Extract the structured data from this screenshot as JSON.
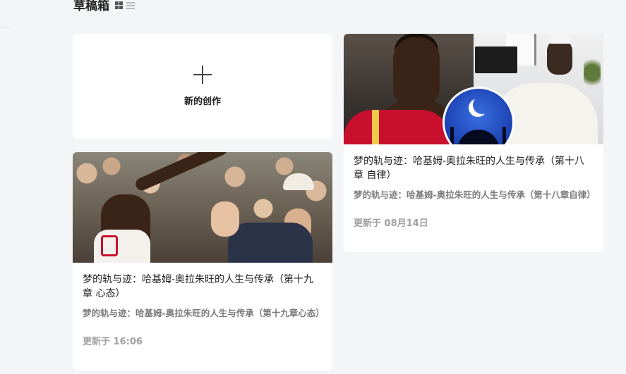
{
  "header": {
    "title": "草稿箱"
  },
  "new_card": {
    "label": "新的创作"
  },
  "drafts": [
    {
      "title": "梦的轨与迹：哈基姆-奥拉朱旺的人生与传承（第十八章 自律）",
      "excerpt": "梦的轨与迹：哈基姆-奥拉朱旺的人生与传承（第十八章自律）",
      "date": "更新于 08月14日"
    },
    {
      "title": "梦的轨与迹：哈基姆-奥拉朱旺的人生与传承（第十九章 心态）",
      "excerpt": "梦的轨与迹：哈基姆-奥拉朱旺的人生与传承（第十九章心态）",
      "date": "更新于 16:06"
    }
  ]
}
